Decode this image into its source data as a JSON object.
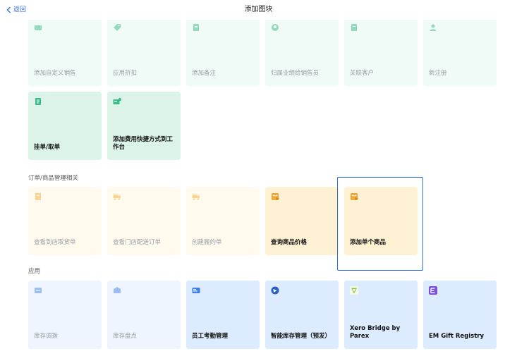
{
  "header": {
    "back_label": "返回",
    "title": "添加图块"
  },
  "top_grid": [
    {
      "label": "添加自定义销售",
      "icon": "cart-icon"
    },
    {
      "label": "应用折扣",
      "icon": "tag-icon"
    },
    {
      "label": "添加备注",
      "icon": "note-icon"
    },
    {
      "label": "归属业绩给销售员",
      "icon": "user-circle-icon"
    },
    {
      "label": "关联客户",
      "icon": "customer-doc-icon"
    },
    {
      "label": "新注册",
      "icon": "user-icon"
    },
    {
      "label": "挂单/取单",
      "icon": "document-icon"
    },
    {
      "label": "添加费用快捷方式到工作台",
      "icon": "fee-card-icon"
    }
  ],
  "section_orders": {
    "title": "订单/商品管理相关",
    "tiles": [
      {
        "label": "查看到店取货单",
        "icon": "pickup-doc-icon"
      },
      {
        "label": "查看门店配送订单",
        "icon": "truck-icon"
      },
      {
        "label": "创建履约单",
        "icon": "truck-icon"
      },
      {
        "label": "查询商品价格",
        "icon": "price-tag-icon"
      },
      {
        "label": "添加单个商品",
        "icon": "product-icon"
      }
    ]
  },
  "section_apps": {
    "title": "应用",
    "tiles": [
      {
        "label": "库存调拨",
        "icon": "inventory-transfer-icon"
      },
      {
        "label": "库存盘点",
        "icon": "inventory-count-icon"
      },
      {
        "label": "员工考勤管理",
        "icon": "attendance-icon"
      },
      {
        "label": "智能库存管理（预发）",
        "icon": "smart-inventory-icon"
      },
      {
        "label": "Xero Bridge by Parex",
        "icon": "xero-bridge-icon"
      },
      {
        "label": "EM Gift Registry",
        "icon": "em-gift-icon"
      }
    ]
  },
  "colors": {
    "accent": "#2f6fe0",
    "green_tile": "#dcf3ea",
    "orange_tile": "#fef1d4",
    "blue_tile": "#dcebfd"
  }
}
